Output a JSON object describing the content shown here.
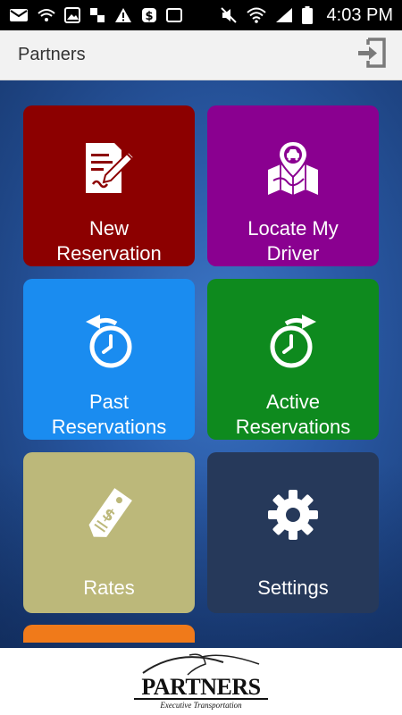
{
  "status_bar": {
    "time": "4:03 PM"
  },
  "app_bar": {
    "title": "Partners"
  },
  "tiles": [
    {
      "label": "New\nReservation",
      "color": "#8c0000",
      "icon": "edit-document-icon"
    },
    {
      "label": "Locate My\nDriver",
      "color": "#8a0090",
      "icon": "map-pin-car-icon"
    },
    {
      "label": "Past\nReservations",
      "color": "#1a8cf0",
      "icon": "clock-back-icon"
    },
    {
      "label": "Active\nReservations",
      "color": "#0e8a1e",
      "icon": "clock-forward-icon"
    },
    {
      "label": "Rates",
      "color": "#bcb87a",
      "icon": "price-tag-icon"
    },
    {
      "label": "Settings",
      "color": "#26395a",
      "icon": "gear-icon"
    }
  ],
  "footer": {
    "brand": "PARTNERS",
    "tagline": "Executive Transportation"
  }
}
